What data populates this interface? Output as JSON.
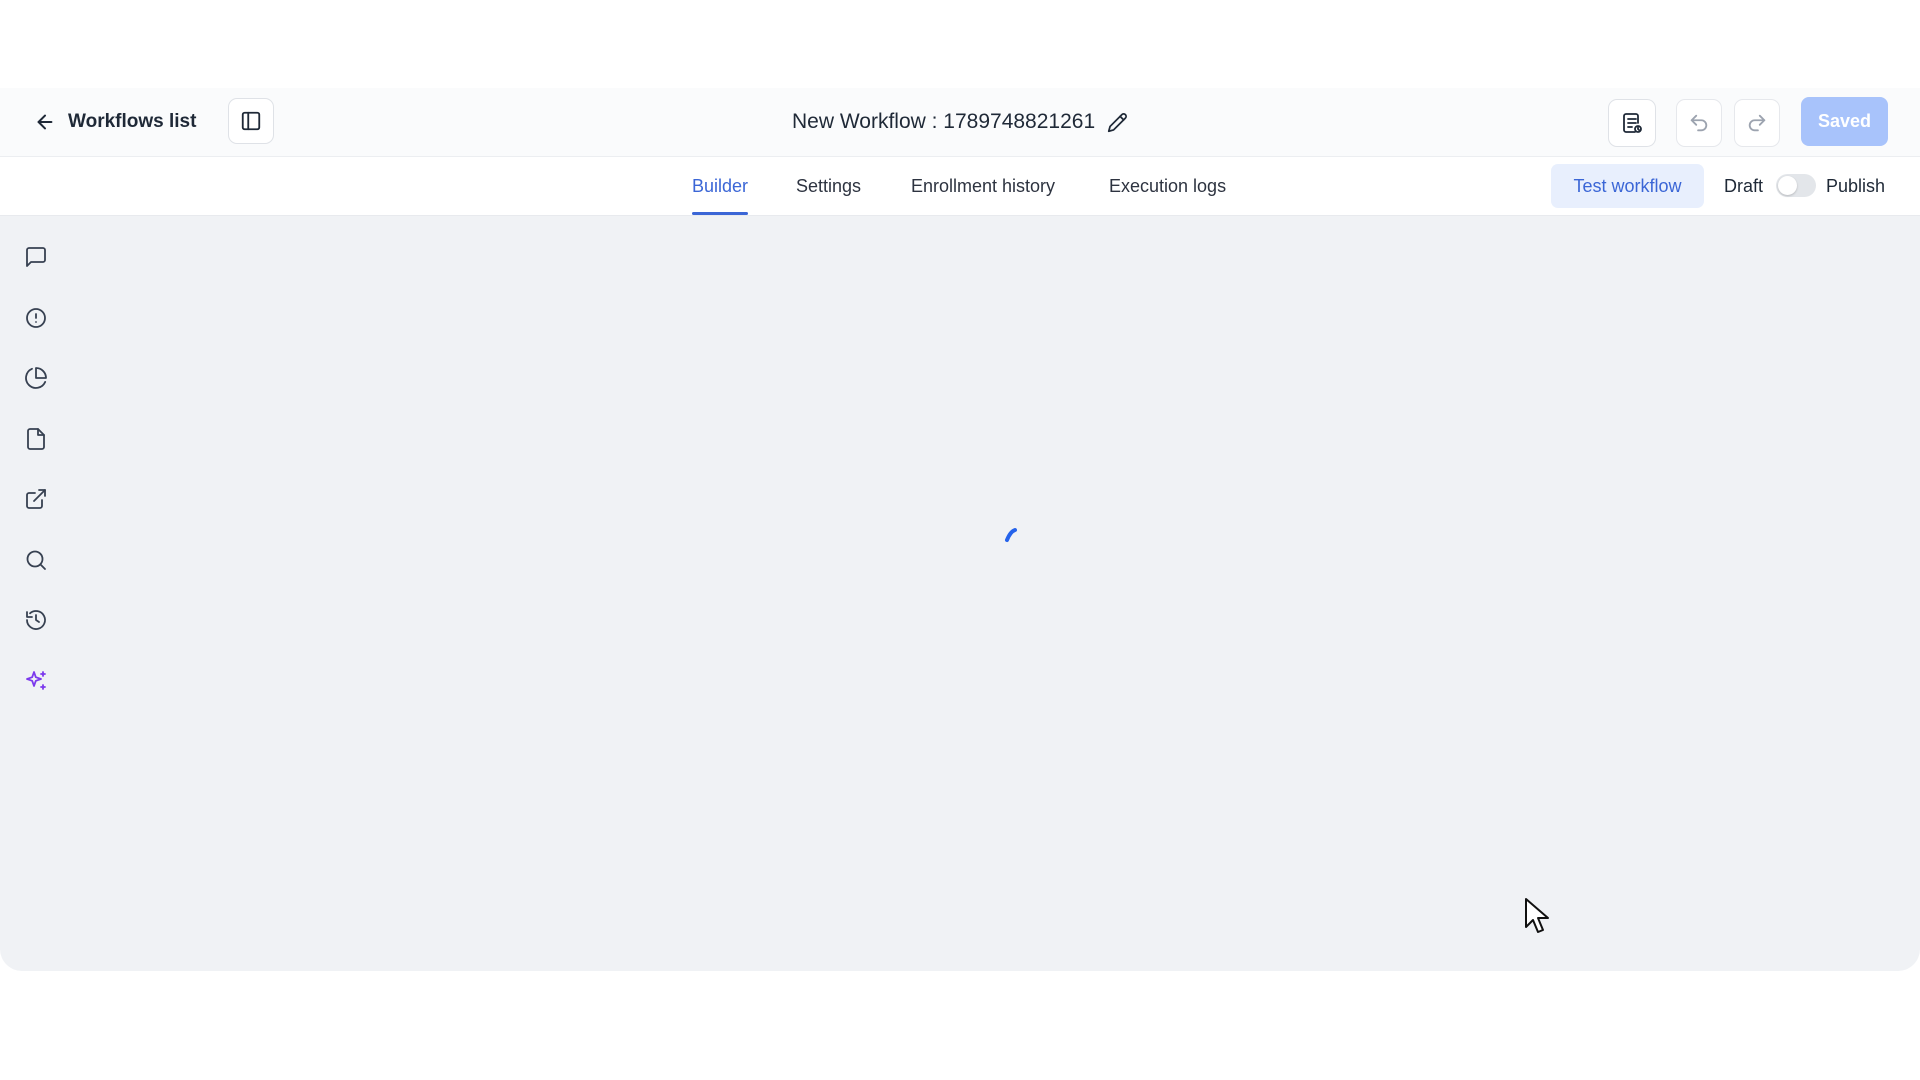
{
  "header": {
    "back_label": "Workflows list",
    "title": "New Workflow : 1789748821261",
    "saved_label": "Saved",
    "icons": {
      "back": "arrow-left-icon",
      "sidebar_toggle": "sidebar-panel-icon",
      "edit_title": "pencil-icon",
      "notes": "notes-icon",
      "undo": "undo-icon",
      "redo": "redo-icon"
    }
  },
  "tabs": [
    {
      "label": "Builder",
      "active": true
    },
    {
      "label": "Settings",
      "active": false
    },
    {
      "label": "Enrollment history",
      "active": false
    },
    {
      "label": "Execution logs",
      "active": false
    }
  ],
  "actions": {
    "test_label": "Test workflow",
    "draft_label": "Draft",
    "publish_label": "Publish",
    "publish_toggle_on": false
  },
  "side_rail": [
    {
      "icon": "message-square-icon"
    },
    {
      "icon": "alert-circle-icon"
    },
    {
      "icon": "pie-chart-icon"
    },
    {
      "icon": "file-icon"
    },
    {
      "icon": "external-link-icon"
    },
    {
      "icon": "search-icon"
    },
    {
      "icon": "history-icon"
    },
    {
      "icon": "sparkles-icon"
    }
  ],
  "colors": {
    "accent": "#3b66d6",
    "saved_button": "#a8c3fb",
    "test_button_bg": "#e8effd",
    "canvas_bg": "#f0f2f5",
    "sparkle": "#7c3aed",
    "spinner": "#2563eb"
  }
}
